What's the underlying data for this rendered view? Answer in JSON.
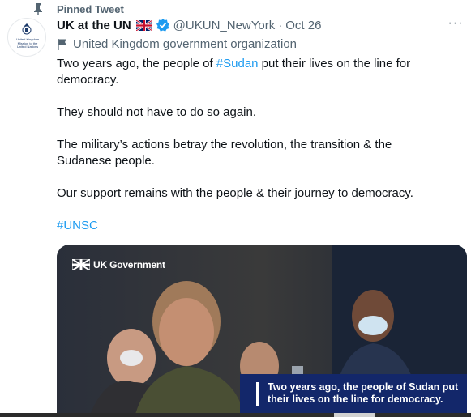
{
  "pinned": {
    "label": "Pinned Tweet",
    "icon": "pin-icon"
  },
  "author": {
    "name": "UK at the UN",
    "flag_emoji": "uk-flag-icon",
    "verified": true,
    "handle": "@UKUN_NewYork",
    "separator": "·",
    "date": "Oct 26",
    "avatar_text": "United Kingdom\nMission to the\nUnited Nations",
    "label": "United Kingdom government organization"
  },
  "more_menu": {
    "label": "···"
  },
  "tweet": {
    "p1_before": "Two years ago, the people of ",
    "p1_hashtag": "#Sudan",
    "p1_after": " put their lives on the line for democracy.",
    "p2": "They should not have to do so again.",
    "p3": "The military’s actions betray the revolution, the transition & the Sudanese people.",
    "p4": "Our support remains with the people & their journey to democracy.",
    "hashtag": "#UNSC"
  },
  "media": {
    "logo_text": "UK Government",
    "caption": "Two years ago, the people of Sudan put their lives on the line for democracy."
  },
  "colors": {
    "link": "#1d9bf0",
    "secondary_text": "#536471",
    "caption_bg": "#13276a",
    "verified": "#1d9bf0"
  }
}
